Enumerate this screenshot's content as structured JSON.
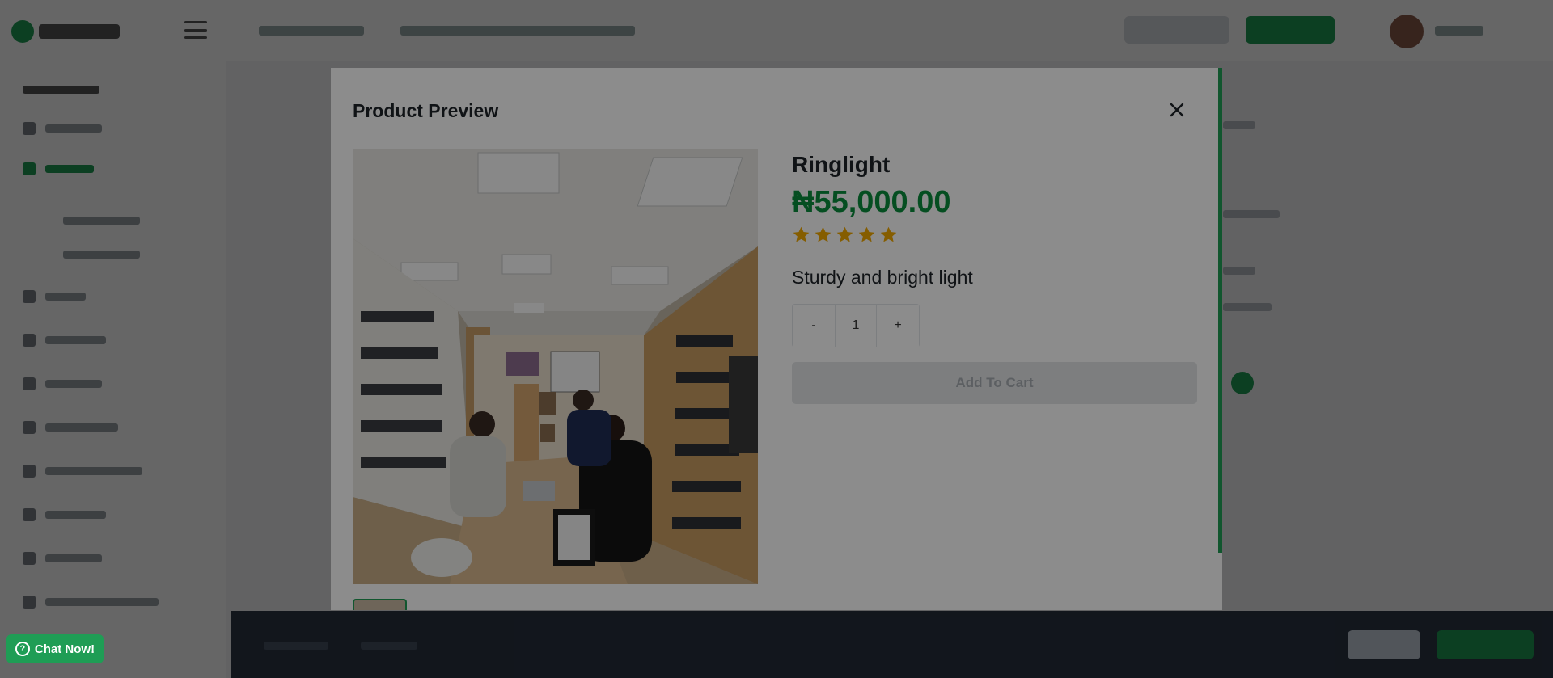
{
  "modal": {
    "title": "Product Preview",
    "close_label": "close"
  },
  "product": {
    "name": "Ringlight",
    "price": "₦55,000.00",
    "rating": 5,
    "rating_max": 5,
    "description": "Sturdy and bright light",
    "quantity": "1",
    "decrement_label": "-",
    "increment_label": "+",
    "add_to_cart_label": "Add To Cart",
    "image_icon": "product-photo-icon"
  },
  "chat": {
    "label": "Chat Now!",
    "icon": "help-circle-icon"
  },
  "colors": {
    "brand_green": "#0a8f3c",
    "star_gold": "#f2a900"
  }
}
